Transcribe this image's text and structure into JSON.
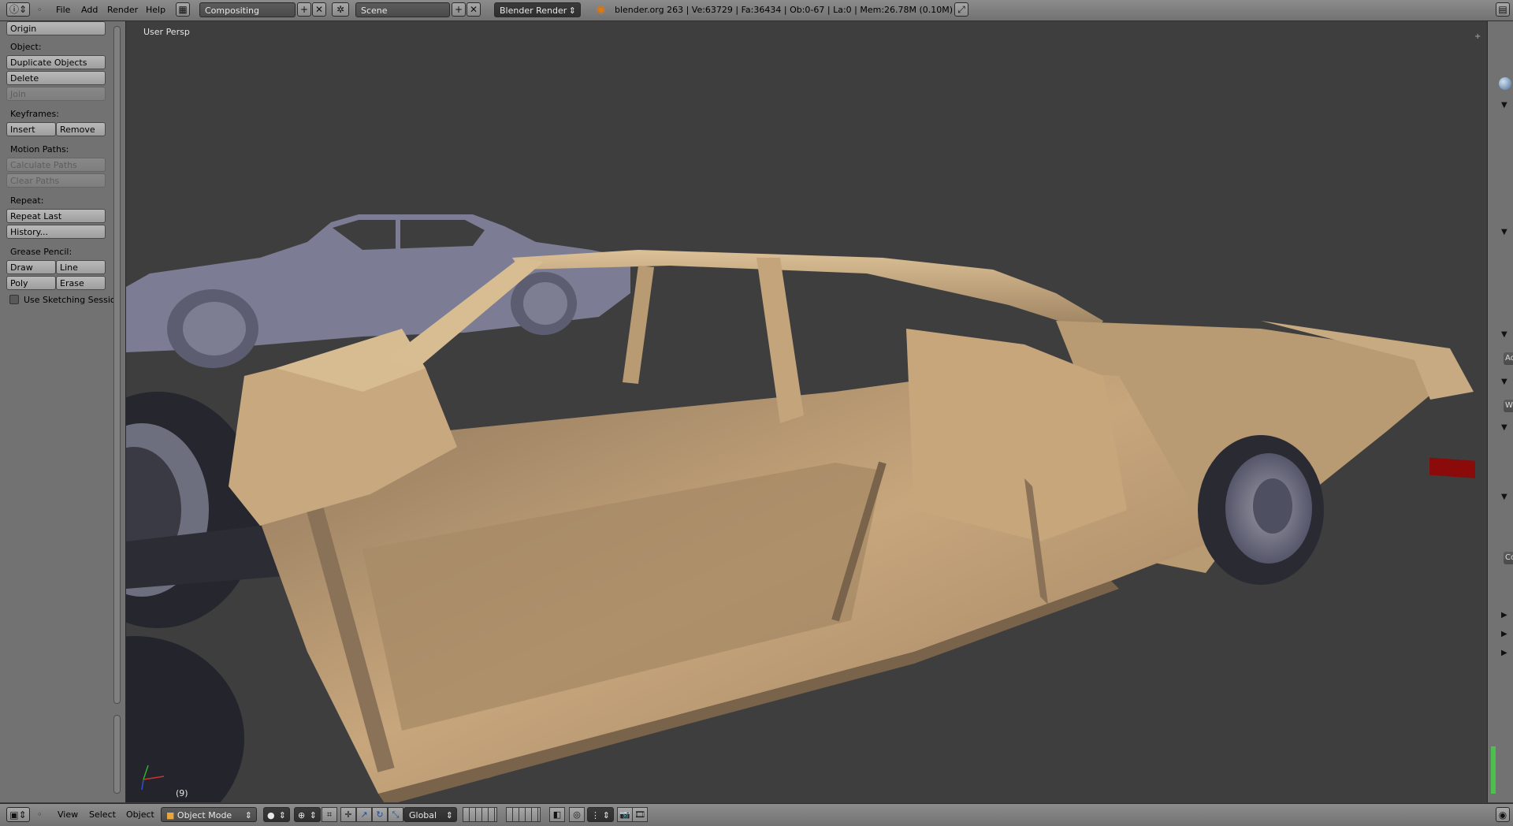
{
  "topbar": {
    "menus": [
      "File",
      "Add",
      "Render",
      "Help"
    ],
    "screen_layout": "Compositing",
    "scene": "Scene",
    "render_engine": "Blender Render",
    "status": "blender.org 263 | Ve:63729 | Fa:36434 | Ob:0-67 | La:0 | Mem:26.78M (0.10M)"
  },
  "shelf": {
    "origin_label": "Origin",
    "object_heading": "Object:",
    "duplicate_label": "Duplicate Objects",
    "delete_label": "Delete",
    "join_label": "Join",
    "keyframes_heading": "Keyframes:",
    "insert_label": "Insert",
    "remove_label": "Remove",
    "motion_heading": "Motion Paths:",
    "calc_paths_label": "Calculate Paths",
    "clear_paths_label": "Clear Paths",
    "repeat_heading": "Repeat:",
    "repeat_last_label": "Repeat Last",
    "history_label": "History...",
    "grease_heading": "Grease Pencil:",
    "draw_label": "Draw",
    "line_label": "Line",
    "poly_label": "Poly",
    "erase_label": "Erase",
    "sketch_label": "Use Sketching Sessio",
    "sketch_checked": false
  },
  "viewport": {
    "persp_label": "User Persp",
    "frame_label": "(9)"
  },
  "rstrip": {
    "chips": [
      "Ac",
      "W",
      "Co"
    ]
  },
  "bottombar": {
    "menus": [
      "View",
      "Select",
      "Object"
    ],
    "mode": "Object Mode",
    "orientation": "Global"
  },
  "colors": {
    "car_body": "#c9a77c",
    "car_shadow": "#8a7258",
    "background_car": "#7c7d94",
    "tyre": "#2a2a33",
    "taillight": "#8b0a0a",
    "viewport_bg": "#3e3e3e"
  }
}
